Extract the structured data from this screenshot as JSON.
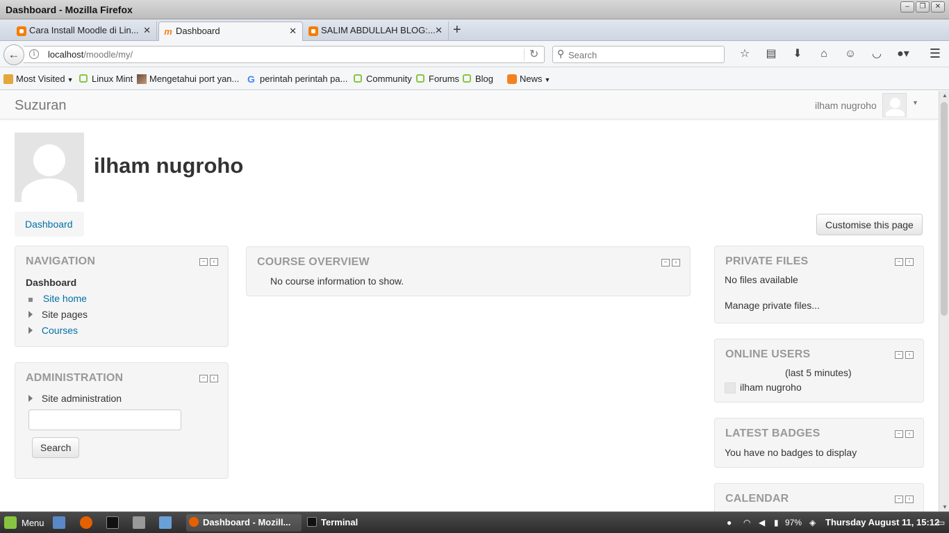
{
  "window": {
    "title": "Dashboard - Mozilla Firefox",
    "buttons": [
      "–",
      "❐",
      "✕"
    ]
  },
  "tabs": [
    {
      "label": "Cara Install Moodle di Lin...",
      "icon": "blogger-icon"
    },
    {
      "label": "Dashboard",
      "icon": "moodle-icon",
      "active": true
    },
    {
      "label": "SALIM ABDULLAH BLOG:...",
      "icon": "blogger-icon"
    }
  ],
  "toolbar": {
    "url_host": "localhost",
    "url_path": "/moodle/my/",
    "search_placeholder": "Search",
    "icons": [
      "star-icon",
      "reading-list-icon",
      "download-icon",
      "home-icon",
      "hello-icon",
      "pocket-icon",
      "adblock-icon",
      "menu-icon"
    ]
  },
  "bookmarks": [
    {
      "label": "Most Visited",
      "icon": "folder-icon",
      "dropdown": true
    },
    {
      "label": "Linux Mint",
      "icon": "mint-icon"
    },
    {
      "label": "Mengetahui port yan...",
      "icon": "photo-icon"
    },
    {
      "label": "perintah perintah pa...",
      "icon": "google-icon"
    },
    {
      "label": "Community",
      "icon": "mint-icon"
    },
    {
      "label": "Forums",
      "icon": "mint-icon"
    },
    {
      "label": "Blog",
      "icon": "mint-icon"
    },
    {
      "label": "News",
      "icon": "rss-icon",
      "dropdown": true
    }
  ],
  "moodle": {
    "site_name": "Suzuran",
    "user_name": "ilham nugroho",
    "page_heading": "ilham nugroho",
    "breadcrumb": "Dashboard",
    "customise_label": "Customise this page"
  },
  "blocks": {
    "navigation": {
      "title": "NAVIGATION",
      "root": "Dashboard",
      "items": [
        {
          "label": "Site home",
          "kind": "leaf",
          "link": true
        },
        {
          "label": "Site pages",
          "kind": "branch",
          "link": false
        },
        {
          "label": "Courses",
          "kind": "branch",
          "link": true
        }
      ]
    },
    "administration": {
      "title": "ADMINISTRATION",
      "item": "Site administration",
      "search_value": "",
      "search_button": "Search"
    },
    "course_overview": {
      "title": "COURSE OVERVIEW",
      "message": "No course information to show."
    },
    "private_files": {
      "title": "PRIVATE FILES",
      "message": "No files available",
      "link": "Manage private files..."
    },
    "online_users": {
      "title": "ONLINE USERS",
      "note": "(last 5 minutes)",
      "user": "ilham nugroho"
    },
    "latest_badges": {
      "title": "LATEST BADGES",
      "message": "You have no badges to display"
    },
    "calendar": {
      "title": "CALENDAR"
    }
  },
  "taskbar": {
    "menu_label": "Menu",
    "tasks": [
      {
        "label": "Dashboard - Mozill...",
        "active": true
      },
      {
        "label": "Terminal",
        "active": false
      }
    ],
    "battery": "97%",
    "clock": "Thursday August 11, 15:12"
  },
  "colors": {
    "link": "#0070a8",
    "block_bg": "#f5f5f5",
    "block_title": "#999999",
    "taskbar": "#3a3a3a",
    "mint_green": "#87c540",
    "blogger_orange": "#f57d00"
  }
}
